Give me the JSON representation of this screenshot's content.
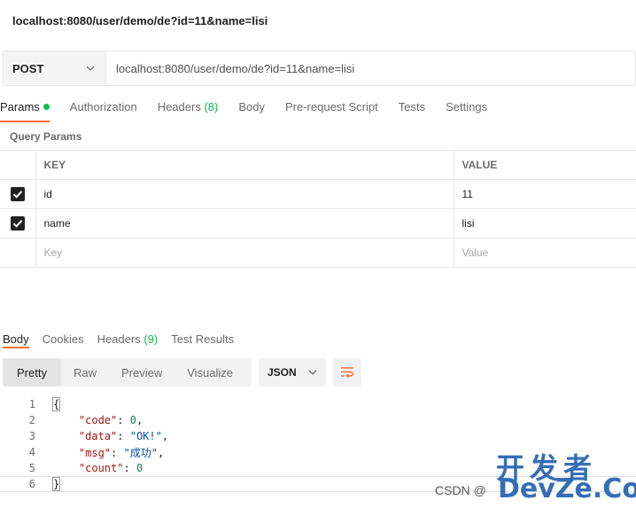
{
  "request": {
    "title": "localhost:8080/user/demo/de?id=11&name=lisi",
    "method": "POST",
    "url": "localhost:8080/user/demo/de?id=11&name=lisi"
  },
  "request_tabs": [
    {
      "label": "Params",
      "active": true
    },
    {
      "label": "Authorization"
    },
    {
      "label": "Headers",
      "count": "(8)"
    },
    {
      "label": "Body"
    },
    {
      "label": "Pre-request Script"
    },
    {
      "label": "Tests"
    },
    {
      "label": "Settings"
    }
  ],
  "query_params": {
    "section_label": "Query Params",
    "headers": {
      "key": "KEY",
      "value": "VALUE"
    },
    "rows": [
      {
        "key": "id",
        "value": "11",
        "checked": true
      },
      {
        "key": "name",
        "value": "lisi",
        "checked": true
      }
    ],
    "placeholders": {
      "key": "Key",
      "value": "Value"
    }
  },
  "response_tabs": [
    {
      "label": "Body",
      "active": true
    },
    {
      "label": "Cookies"
    },
    {
      "label": "Headers",
      "count": "(9)"
    },
    {
      "label": "Test Results"
    }
  ],
  "view_modes": [
    "Pretty",
    "Raw",
    "Preview",
    "Visualize"
  ],
  "format": "JSON",
  "code_lines": {
    "l1": "1",
    "l2": "2",
    "l3": "3",
    "l4": "4",
    "l5": "5",
    "l6": "6",
    "open": "{",
    "code_key": "\"code\"",
    "code_val": "0",
    "data_key": "\"data\"",
    "data_val": "\"OK!\"",
    "msg_key": "\"msg\"",
    "msg_val": "\"成功\"",
    "count_key": "\"count\"",
    "count_val": "0",
    "close": "}"
  },
  "watermark": {
    "brand_cn": "开发者",
    "brand_en": "DevZe.CoM",
    "csdn": "CSDN @"
  },
  "colors": {
    "accent": "#ff6c37",
    "green": "#0cbb52"
  }
}
